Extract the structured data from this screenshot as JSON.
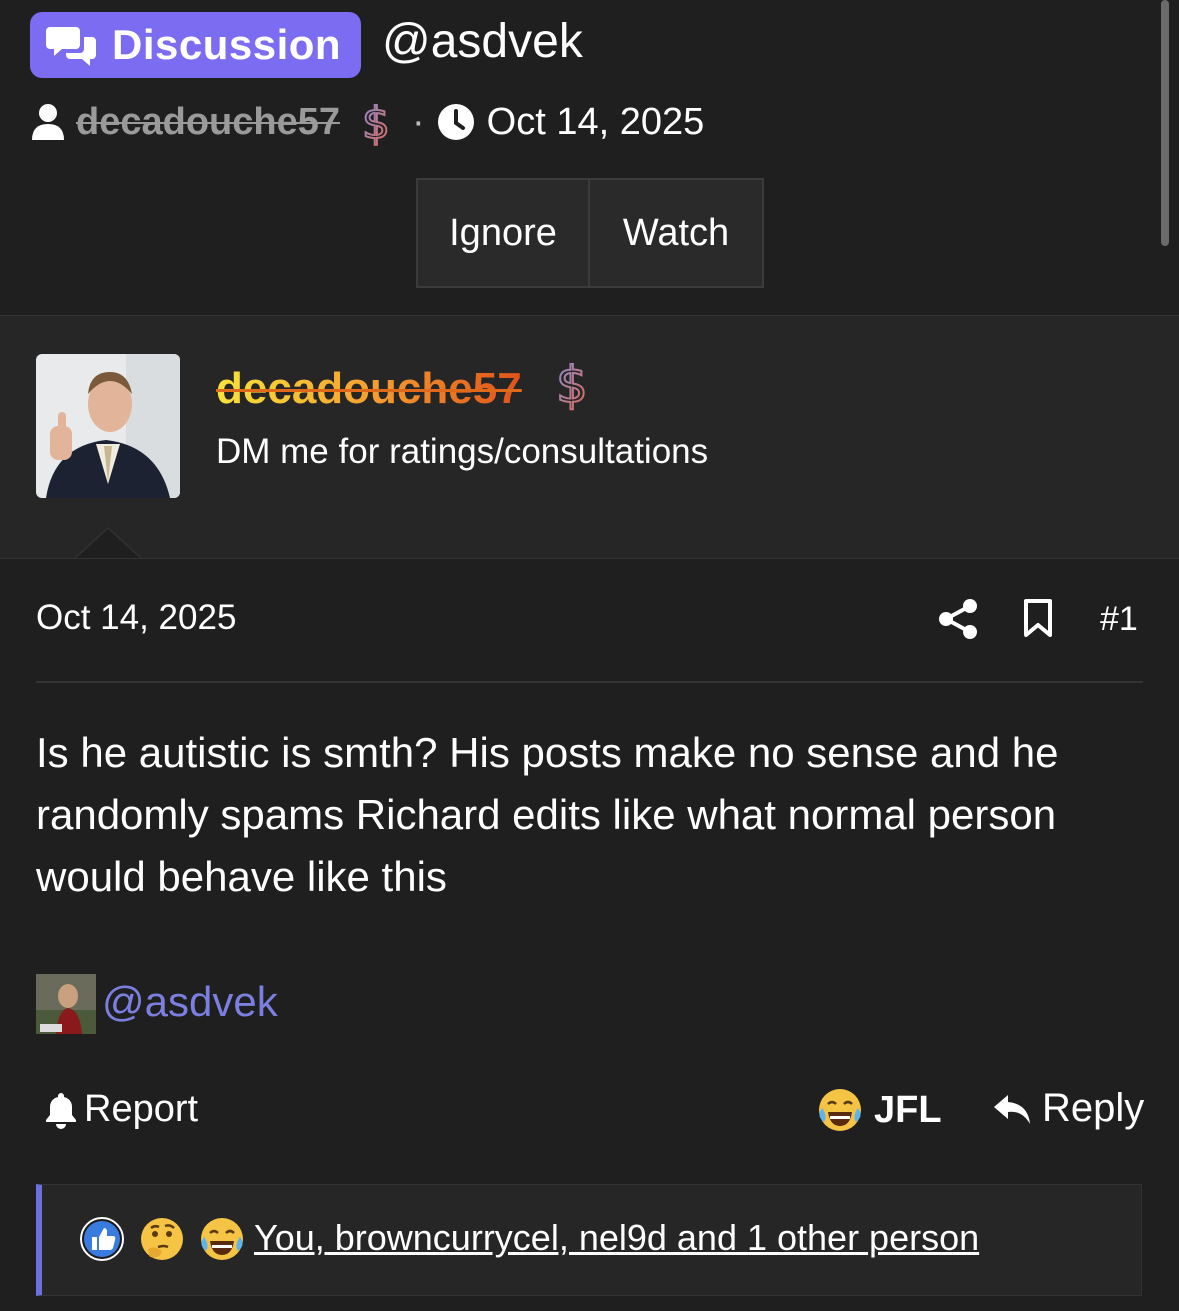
{
  "header": {
    "badge_label": "Discussion",
    "thread_title": "@asdvek",
    "author": "decadouche57",
    "date": "Oct 14, 2025",
    "separator": "·"
  },
  "actions": {
    "ignore_label": "Ignore",
    "watch_label": "Watch"
  },
  "post": {
    "username": "decadouche57",
    "user_title": "DM me for ratings/consultations",
    "date": "Oct 14, 2025",
    "number": "#1",
    "body": "Is he autistic is smth? His posts make no sense and he randomly spams Richard edits like what normal person would behave like this",
    "mention": "@asdvek",
    "report_label": "Report",
    "jfl_label": "JFL",
    "reply_label": "Reply",
    "reactions_text": "You, browncurrycel, nel9d and 1 other person"
  },
  "icons": {
    "badge": "chat-bubbles-icon",
    "author": "user-icon",
    "supporter": "dollar-icon",
    "time": "clock-icon",
    "share": "share-icon",
    "bookmark": "bookmark-icon",
    "report": "bell-icon",
    "jfl": "crying-laughing-emoji",
    "reply": "reply-arrow-icon",
    "reactions": [
      "like-icon",
      "thinking-emoji",
      "crying-laughing-emoji"
    ]
  },
  "colors": {
    "background": "#1f1f1f",
    "panel": "#262626",
    "badge": "#7c6cf2",
    "mention": "#7b7fe0",
    "accent_border": "#6c6fe0"
  }
}
